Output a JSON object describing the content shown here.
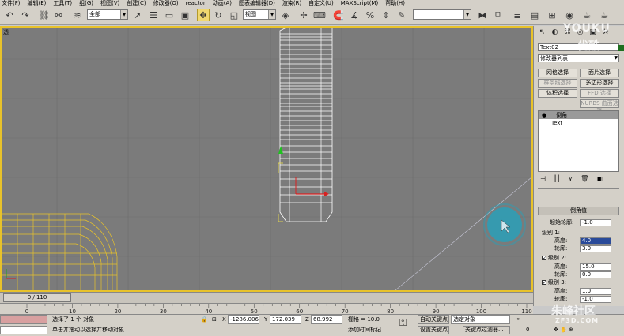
{
  "menu": [
    "文件(F)",
    "编辑(E)",
    "工具(T)",
    "组(G)",
    "视图(V)",
    "创建(C)",
    "修改器(O)",
    "reactor",
    "动画(A)",
    "图表编辑器(D)",
    "渲染(R)",
    "自定义(U)",
    "MAXScript(M)",
    "帮助(H)"
  ],
  "toolbar": {
    "selection_filter": "全部",
    "reference_coord": "视图",
    "named_selection": ""
  },
  "viewport": {
    "label": "透",
    "active_color": "#e8c22a",
    "background": "#7b7b7b"
  },
  "command_panel": {
    "object_name": "Text02",
    "object_color": "#1e6e1e",
    "modifier_list": "修改器列表",
    "buttons": {
      "grid_select": "网格选择",
      "patch_select": "面片选择",
      "spline_select": "样条线选择",
      "multi_select": "多边形选择",
      "volume_select": "体积选择",
      "ffd_select": "FFD 选择",
      "nurbs_select": "NURBS 曲面选择"
    },
    "stack": {
      "modifier": "倒角",
      "base": "Text"
    },
    "rollout_title": "倒角值",
    "start_outline_label": "起始轮廓:",
    "start_outline_value": "-1.0",
    "level1_label": "级别 1:",
    "level1_height_label": "高度:",
    "level1_height_value": "4.0",
    "level1_outline_label": "轮廓:",
    "level1_outline_value": "3.0",
    "level2_label": "级别 2:",
    "level2_height_label": "高度:",
    "level2_height_value": "15.0",
    "level2_outline_label": "轮廓:",
    "level2_outline_value": "0.0",
    "level3_label": "级别 3:",
    "level3_height_label": "高度:",
    "level3_height_value": "1.0",
    "level3_outline_label": "轮廓:",
    "level3_outline_value": "-1.0"
  },
  "timeline": {
    "slider": "0 / 110",
    "ticks": [
      "0",
      "10",
      "20",
      "30",
      "40",
      "50",
      "60",
      "70",
      "80",
      "90",
      "100",
      "110"
    ]
  },
  "status": {
    "selected": "选择了 1 个 对象",
    "prompt": "单击并拖动以选择并移动对象",
    "x_label": "X",
    "x_value": "-1286.006",
    "y_label": "Y",
    "y_value": "172.039",
    "z_label": "Z",
    "z_value": "68.992",
    "grid": "栅格 = 10.0",
    "add_time_tag": "添加时间标记",
    "auto_key": "自动关键点",
    "set_key": "设置关键点",
    "key_filter_select": "选定对象",
    "key_filters": "关键点过滤器..."
  },
  "watermarks": {
    "youku_en": "YOUKU",
    "youku_cn": "优酷",
    "zhufeng": "朱峰社区",
    "zhufeng_en": "ZF3D.COM"
  }
}
